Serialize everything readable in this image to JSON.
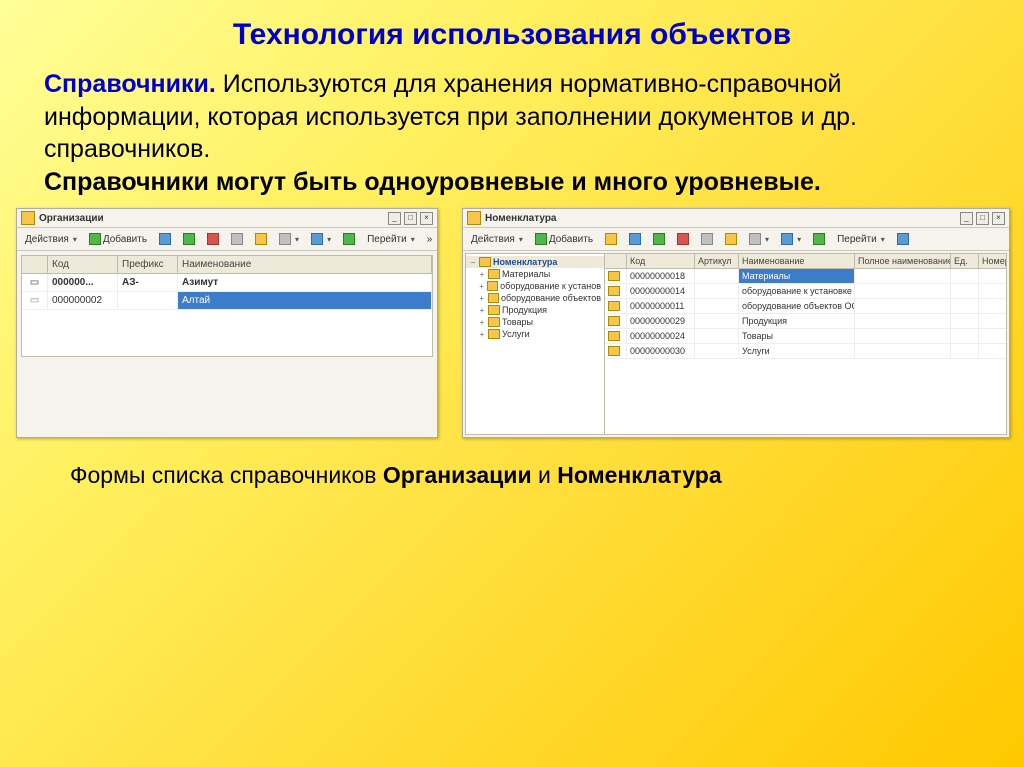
{
  "slide": {
    "title": "Технология использования объектов",
    "lead": "Справочники.",
    "para1": " Используются для хранения нормативно-справочной информации, которая используется при заполнении документов и др. справочников.",
    "para2": "Справочники могут быть одноуровневые и много уровневые.",
    "caption_pre": "Формы списка справочников ",
    "caption_b1": "Организации",
    "caption_mid": " и ",
    "caption_b2": "Номенклатура"
  },
  "org": {
    "title": "Организации",
    "toolbar": {
      "actions": "Действия",
      "add": "Добавить",
      "goto": "Перейти"
    },
    "columns": {
      "c0": "",
      "c1": "Код",
      "c2": "Префикс",
      "c3": "Наименование"
    },
    "rows": [
      {
        "ind": "▭",
        "code": "000000...",
        "prefix": "АЗ-",
        "name": "Азимут"
      },
      {
        "ind": "▭",
        "code": "000000002",
        "prefix": "",
        "name": "Алтай"
      }
    ]
  },
  "nom": {
    "title": "Номенклатура",
    "toolbar": {
      "actions": "Действия",
      "add": "Добавить",
      "goto": "Перейти"
    },
    "tree": [
      {
        "exp": "−",
        "label": "Номенклатура",
        "sel": true
      },
      {
        "exp": "+",
        "label": "Материалы"
      },
      {
        "exp": "+",
        "label": "оборудование к установ"
      },
      {
        "exp": "+",
        "label": "оборудование объектов"
      },
      {
        "exp": "+",
        "label": "Продукция"
      },
      {
        "exp": "+",
        "label": "Товары"
      },
      {
        "exp": "+",
        "label": "Услуги"
      }
    ],
    "columns": {
      "c0": "",
      "c1": "Код",
      "c2": "Артикул",
      "c3": "Наименование",
      "c4": "Полное наименование",
      "c5": "Ед.",
      "c6": "Номер"
    },
    "rows": [
      {
        "code": "00000000018",
        "art": "",
        "name": "Материалы"
      },
      {
        "code": "00000000014",
        "art": "",
        "name": "оборудование к установке"
      },
      {
        "code": "00000000011",
        "art": "",
        "name": "оборудование объектов ОС"
      },
      {
        "code": "00000000029",
        "art": "",
        "name": "Продукция"
      },
      {
        "code": "00000000024",
        "art": "",
        "name": "Товары"
      },
      {
        "code": "00000000030",
        "art": "",
        "name": "Услуги"
      }
    ]
  }
}
